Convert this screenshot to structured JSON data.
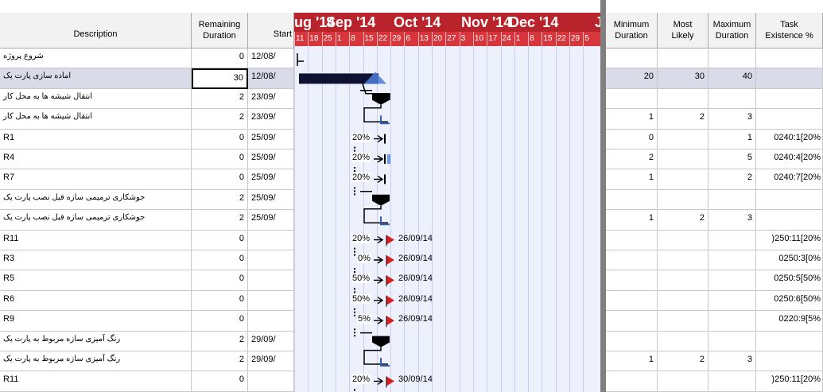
{
  "columns": {
    "description": "Description",
    "remaining": [
      "Remaining",
      "Duration"
    ],
    "start": "Start",
    "minimum": [
      "Minimum",
      "Duration"
    ],
    "most": [
      "Most",
      "Likely"
    ],
    "maximum": [
      "Maximum",
      "Duration"
    ],
    "task": [
      "Task",
      "Existence %"
    ]
  },
  "rows": [
    {
      "desc": "شروع پروژه",
      "rem": "0",
      "start": "12/08/",
      "min": "",
      "most": "",
      "max": "",
      "task": ""
    },
    {
      "desc": "اماده سازی پارت یک",
      "rem": "30",
      "start": "12/08/",
      "min": "20",
      "most": "30",
      "max": "40",
      "task": ""
    },
    {
      "desc": "انتقال شیشه ها به محل کار",
      "rem": "2",
      "start": "23/09/",
      "min": "",
      "most": "",
      "max": "",
      "task": ""
    },
    {
      "desc": "انتقال شیشه ها به محل کار",
      "rem": "2",
      "start": "23/09/",
      "min": "1",
      "most": "2",
      "max": "3",
      "task": ""
    },
    {
      "desc": "R1",
      "rem": "0",
      "start": "25/09/",
      "min": "0",
      "most": "",
      "max": "1",
      "task": "0240:1[20%"
    },
    {
      "desc": "R4",
      "rem": "0",
      "start": "25/09/",
      "min": "2",
      "most": "",
      "max": "5",
      "task": "0240:4[20%"
    },
    {
      "desc": "R7",
      "rem": "0",
      "start": "25/09/",
      "min": "1",
      "most": "",
      "max": "2",
      "task": "0240:7[20%"
    },
    {
      "desc": "جوشکاری ترمیمی سازه قبل نصب پارت یک",
      "rem": "2",
      "start": "25/09/",
      "min": "",
      "most": "",
      "max": "",
      "task": ""
    },
    {
      "desc": "جوشکاری ترمیمی سازه قبل نصب پارت یک",
      "rem": "2",
      "start": "25/09/",
      "min": "1",
      "most": "2",
      "max": "3",
      "task": ""
    },
    {
      "desc": "R11",
      "rem": "0",
      "start": "",
      "min": "",
      "most": "",
      "max": "",
      "task": ")250:11[20%"
    },
    {
      "desc": "R3",
      "rem": "0",
      "start": "",
      "min": "",
      "most": "",
      "max": "",
      "task": "0250:3[0%"
    },
    {
      "desc": "R5",
      "rem": "0",
      "start": "",
      "min": "",
      "most": "",
      "max": "",
      "task": "0250:5[50%"
    },
    {
      "desc": "R6",
      "rem": "0",
      "start": "",
      "min": "",
      "most": "",
      "max": "",
      "task": "0250:6[50%"
    },
    {
      "desc": "R9",
      "rem": "0",
      "start": "",
      "min": "",
      "most": "",
      "max": "",
      "task": "0220:9[5%"
    },
    {
      "desc": "رنگ آمیزی سازه مربوط به پارت یک",
      "rem": "2",
      "start": "29/09/",
      "min": "",
      "most": "",
      "max": "",
      "task": ""
    },
    {
      "desc": "رنگ آمیزی سازه مربوط به پارت یک",
      "rem": "2",
      "start": "29/09/",
      "min": "1",
      "most": "2",
      "max": "3",
      "task": ""
    },
    {
      "desc": "R11",
      "rem": "0",
      "start": "",
      "min": "",
      "most": "",
      "max": "",
      "task": ")250:11[20%"
    }
  ],
  "gantt": {
    "months": [
      "ug '14",
      "Sep '14",
      "Oct '14",
      "Nov '14",
      "Dec '14",
      "J"
    ],
    "days": [
      "11",
      "18",
      "25",
      "1",
      "8",
      "15",
      "22",
      "29",
      "6",
      "13",
      "20",
      "27",
      "3",
      "10",
      "17",
      "24",
      "1",
      "8",
      "15",
      "22",
      "29",
      "5"
    ],
    "labels": [
      {
        "pct": "20%",
        "date": ""
      },
      {
        "pct": "20%",
        "date": ""
      },
      {
        "pct": "20%",
        "date": ""
      },
      {
        "pct": "20%",
        "date": "26/09/14"
      },
      {
        "pct": "0%",
        "date": "26/09/14"
      },
      {
        "pct": "50%",
        "date": "26/09/14"
      },
      {
        "pct": "50%",
        "date": "26/09/14"
      },
      {
        "pct": "5%",
        "date": "26/09/14"
      },
      {
        "pct": "20%",
        "date": "30/09/14"
      }
    ]
  },
  "colors": {
    "header_red": "#b9232b",
    "day_red": "#d8363d",
    "bar": "#0d1230",
    "accent_blue": "#3a6fd0",
    "gantt_bg": "#eef1fb"
  }
}
